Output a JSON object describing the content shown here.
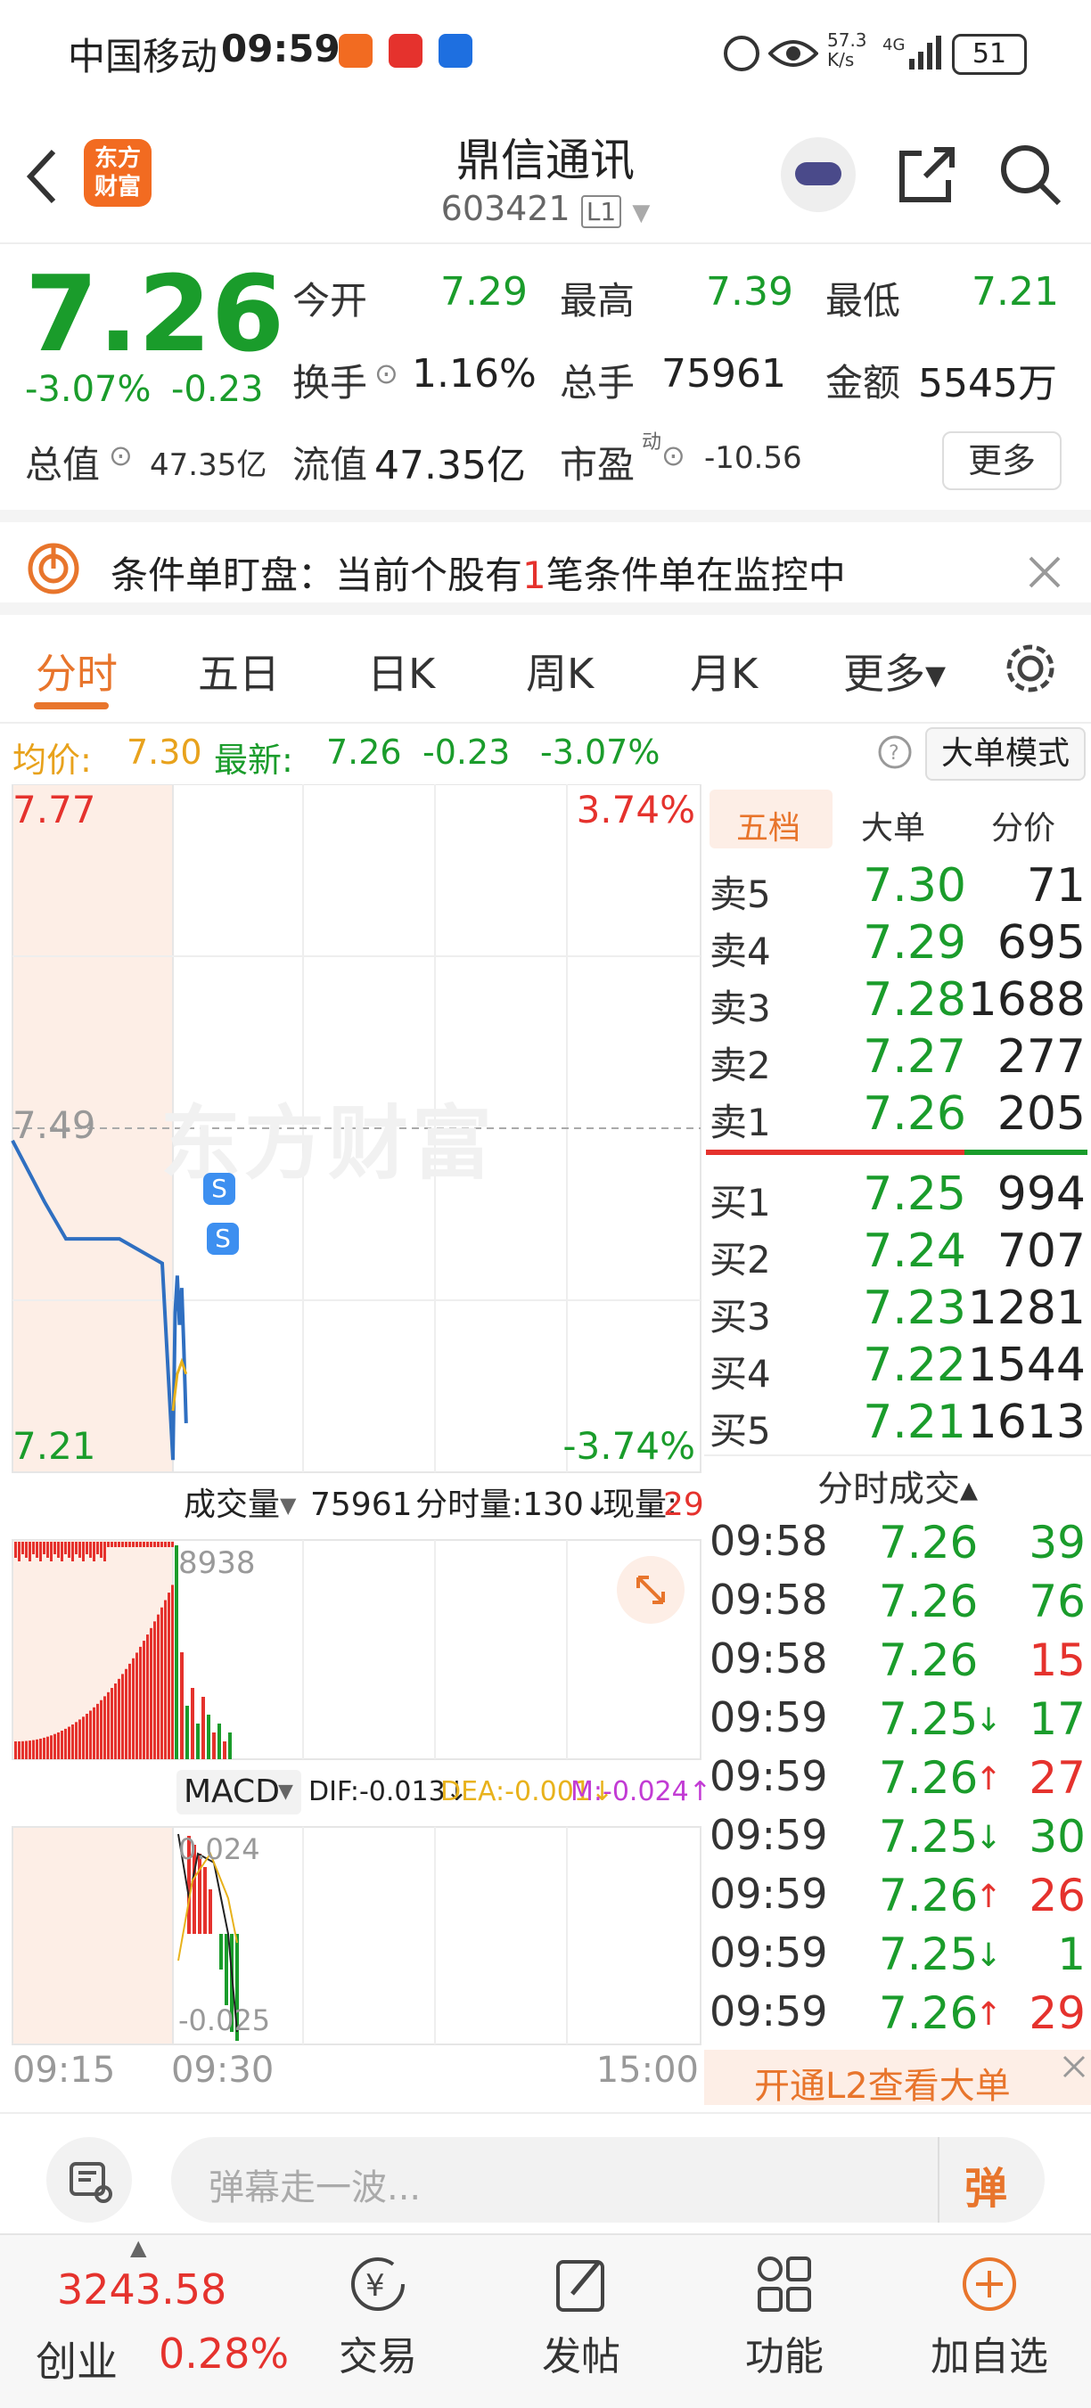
{
  "status_bar": {
    "carrier": "中国移动",
    "time": "09:59",
    "net_speed": "57.3\nK/s",
    "battery": "51"
  },
  "header": {
    "title": "鼎信通讯",
    "code": "603421",
    "level_badge": "L1",
    "logo_text": "东方\n财富"
  },
  "quote": {
    "price": "7.26",
    "change_pct": "-3.07%",
    "change": "-0.23",
    "open_label": "今开",
    "open": "7.29",
    "high_label": "最高",
    "high": "7.39",
    "low_label": "最低",
    "low": "7.21",
    "turnover_label": "换手",
    "turnover": "1.16%",
    "volume_label": "总手",
    "volume": "75961",
    "amount_label": "金额",
    "amount": "5545万",
    "mktcap_label": "总值",
    "mktcap": "47.35亿",
    "float_label": "流值",
    "float_cap": "47.35亿",
    "pe_label": "市盈",
    "pe_sup": "动",
    "pe": "-10.56",
    "more_label": "更多"
  },
  "notice": {
    "pre": "条件单盯盘：当前个股有",
    "num": "1",
    "post": "笔条件单在监控中"
  },
  "tabs": [
    "分时",
    "五日",
    "日K",
    "周K",
    "月K",
    "更多▾"
  ],
  "avg_line": {
    "avg_label": "均价:",
    "avg": "7.30",
    "latest_label": "最新:",
    "latest": "7.26",
    "chg": "-0.23",
    "chg_pct": "-3.07%",
    "mode_btn": "大单模式"
  },
  "chart": {
    "y_top": "7.77",
    "y_mid": "7.49",
    "y_bot": "7.21",
    "pct_top": "3.74%",
    "pct_bot": "-3.74%",
    "watermark": "东方财富",
    "vol_label": "成交量",
    "vol_total": "75961",
    "vol_bar_label": "分时量:130↓",
    "vol_now_label": "现量:",
    "vol_now": "29",
    "vol_max": "8938",
    "macd_label": "MACD",
    "dif": "DIF:-0.013↓",
    "dea": "DEA:-0.001↓",
    "m": "M:-0.024↑",
    "macd_max": "0.024",
    "macd_min": "-0.025",
    "t_start": "09:15",
    "t_open": "09:30",
    "t_end": "15:00",
    "signal_icon": "S"
  },
  "chart_data": {
    "type": "line",
    "title": "",
    "series": [
      {
        "name": "",
        "x": [
          "09:15",
          "09:18",
          "09:20",
          "09:25",
          "09:29",
          "09:30",
          "09:31",
          "09:32",
          "09:33",
          "09:34",
          "09:35",
          "09:36"
        ],
        "values": [
          7.48,
          7.43,
          7.4,
          7.4,
          7.38,
          7.22,
          7.34,
          7.37,
          7.33,
          7.36,
          7.31,
          7.25
        ]
      },
      {
        "name": "",
        "x": [
          "09:30",
          "09:32",
          "09:34",
          "09:36"
        ],
        "values": [
          7.26,
          7.29,
          7.3,
          7.29
        ]
      }
    ],
    "ylim": [
      7.21,
      7.77
    ]
  },
  "book": {
    "tabs": [
      "五档",
      "大单",
      "分价"
    ],
    "asks": [
      {
        "label": "卖5",
        "price": "7.30",
        "vol": "71"
      },
      {
        "label": "卖4",
        "price": "7.29",
        "vol": "695"
      },
      {
        "label": "卖3",
        "price": "7.28",
        "vol": "1688"
      },
      {
        "label": "卖2",
        "price": "7.27",
        "vol": "277"
      },
      {
        "label": "卖1",
        "price": "7.26",
        "vol": "205"
      }
    ],
    "bids": [
      {
        "label": "买1",
        "price": "7.25",
        "vol": "994"
      },
      {
        "label": "买2",
        "price": "7.24",
        "vol": "707"
      },
      {
        "label": "买3",
        "price": "7.23",
        "vol": "1281"
      },
      {
        "label": "买4",
        "price": "7.22",
        "vol": "1544"
      },
      {
        "label": "买5",
        "price": "7.21",
        "vol": "1613"
      }
    ],
    "ticks_title": "分时成交▴",
    "ticks": [
      {
        "t": "09:58",
        "p": "7.26",
        "arrow": "",
        "v": "39",
        "dir": "green"
      },
      {
        "t": "09:58",
        "p": "7.26",
        "arrow": "",
        "v": "76",
        "dir": "green"
      },
      {
        "t": "09:58",
        "p": "7.26",
        "arrow": "",
        "v": "15",
        "dir": "red"
      },
      {
        "t": "09:59",
        "p": "7.25",
        "arrow": "↓",
        "v": "17",
        "dir": "green"
      },
      {
        "t": "09:59",
        "p": "7.26",
        "arrow": "↑",
        "v": "27",
        "dir": "red"
      },
      {
        "t": "09:59",
        "p": "7.25",
        "arrow": "↓",
        "v": "30",
        "dir": "green"
      },
      {
        "t": "09:59",
        "p": "7.26",
        "arrow": "↑",
        "v": "26",
        "dir": "red"
      },
      {
        "t": "09:59",
        "p": "7.25",
        "arrow": "↓",
        "v": "1",
        "dir": "green"
      },
      {
        "t": "09:59",
        "p": "7.26",
        "arrow": "↑",
        "v": "29",
        "dir": "red"
      }
    ],
    "l2_banner": "开通L2查看大单"
  },
  "comment": {
    "placeholder": "弹幕走一波...",
    "danmu_btn": "弹"
  },
  "nav": {
    "index_value": "3243.58",
    "index_name": "创业",
    "index_pct": "0.28%",
    "items": [
      "交易",
      "发帖",
      "功能",
      "加自选"
    ]
  },
  "colors": {
    "red": "#e5322d",
    "green": "#1a9c2b",
    "accent": "#e8752c",
    "pre_market_bg": "#fdeee6"
  }
}
